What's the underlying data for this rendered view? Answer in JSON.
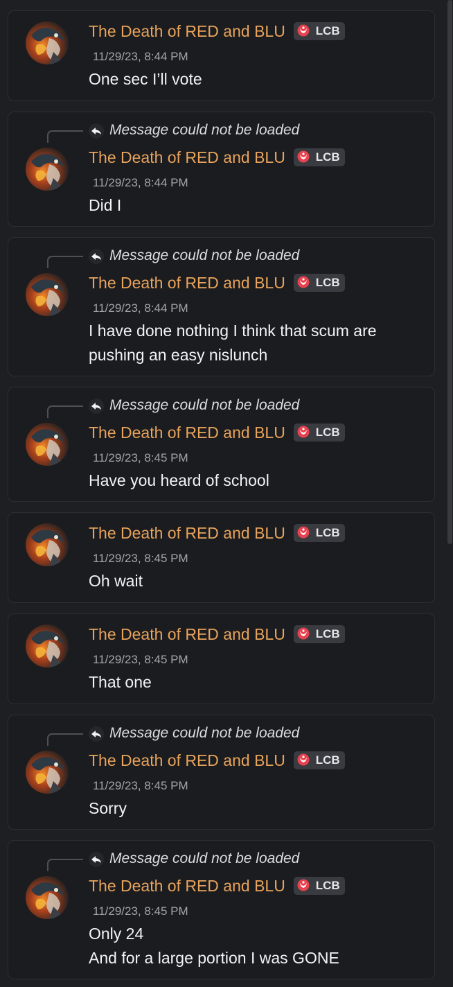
{
  "colors": {
    "background": "#1e1f22",
    "card": "#1b1c1f",
    "author": "#e8a35c",
    "timestamp": "#a2a5ab",
    "text": "#f2f3f5",
    "tag_bg": "#3a3b40",
    "tag_icon": "#e8424f"
  },
  "messages": [
    {
      "author": "The Death of RED and BLU",
      "tag": "LCB",
      "timestamp": "11/29/23, 8:44 PM",
      "reply_text": "",
      "lines": [
        "One sec I’ll vote"
      ]
    },
    {
      "author": "The Death of RED and BLU",
      "tag": "LCB",
      "timestamp": "11/29/23, 8:44 PM",
      "reply_text": "Message could not be loaded",
      "lines": [
        "Did I"
      ]
    },
    {
      "author": "The Death of RED and BLU",
      "tag": "LCB",
      "timestamp": "11/29/23, 8:44 PM",
      "reply_text": "Message could not be loaded",
      "lines": [
        "I have done nothing I think that scum are",
        "pushing an easy nislunch"
      ]
    },
    {
      "author": "The Death of RED and BLU",
      "tag": "LCB",
      "timestamp": "11/29/23, 8:45 PM",
      "reply_text": "Message could not be loaded",
      "lines": [
        "Have you heard of school"
      ]
    },
    {
      "author": "The Death of RED and BLU",
      "tag": "LCB",
      "timestamp": "11/29/23, 8:45 PM",
      "reply_text": "",
      "lines": [
        "Oh wait"
      ]
    },
    {
      "author": "The Death of RED and BLU",
      "tag": "LCB",
      "timestamp": "11/29/23, 8:45 PM",
      "reply_text": "",
      "lines": [
        "That one"
      ]
    },
    {
      "author": "The Death of RED and BLU",
      "tag": "LCB",
      "timestamp": "11/29/23, 8:45 PM",
      "reply_text": "Message could not be loaded",
      "lines": [
        "Sorry"
      ]
    },
    {
      "author": "The Death of RED and BLU",
      "tag": "LCB",
      "timestamp": "11/29/23, 8:45 PM",
      "reply_text": "Message could not be loaded",
      "lines": [
        "Only 24",
        "And for a large portion I was GONE"
      ]
    }
  ],
  "icons": {
    "avatar": "avatar-icon",
    "reply": "reply-arrow-icon",
    "tag": "guild-tag-icon"
  }
}
